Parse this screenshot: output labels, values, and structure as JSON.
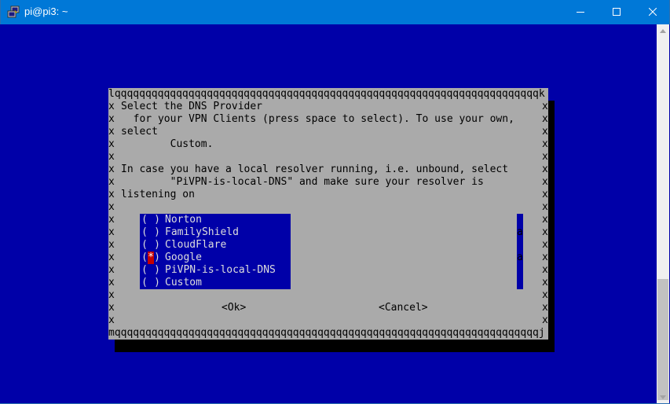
{
  "window": {
    "title": "pi@pi3: ~",
    "icon": "putty-icon"
  },
  "dialog": {
    "border_top": "lqqqqqqqqqqqqqqqqqqqqqqqqqqqqqqqqqqqqqqqqqqqqqqqqqqqqqqqqqqqqqqqqqqqqqk",
    "border_bottom": "mqqqqqqqqqqqqqqqqqqqqqqqqqqqqqqqqqqqqqqqqqqqqqqqqqqqqqqqqqqqqqqqqqqqqqj",
    "side_char": "x",
    "lines": [
      "Select the DNS Provider",
      "  for your VPN Clients (press space to select). To use your own,",
      "select",
      "        Custom.",
      "",
      "In case you have a local resolver running, i.e. unbound, select",
      "        \"PiVPN-is-local-DNS\" and make sure your resolver is",
      "listening on"
    ],
    "options": [
      {
        "label": "Norton",
        "mark": " ",
        "selected": false
      },
      {
        "label": "FamilyShield",
        "mark": " ",
        "selected": false
      },
      {
        "label": "CloudFlare",
        "mark": " ",
        "selected": false
      },
      {
        "label": "Google",
        "mark": "*",
        "selected": true
      },
      {
        "label": "PiVPN-is-local-DNS",
        "mark": " ",
        "selected": false
      },
      {
        "label": "Custom",
        "mark": " ",
        "selected": false
      }
    ],
    "scroll_marks": [
      "a",
      "a"
    ],
    "ok_label": "<Ok>",
    "cancel_label": "<Cancel>"
  },
  "colors": {
    "terminal_bg": "#0000a8",
    "dialog_bg": "#aaaaaa",
    "titlebar": "#0078d7",
    "selected_mark": "#c40000"
  }
}
